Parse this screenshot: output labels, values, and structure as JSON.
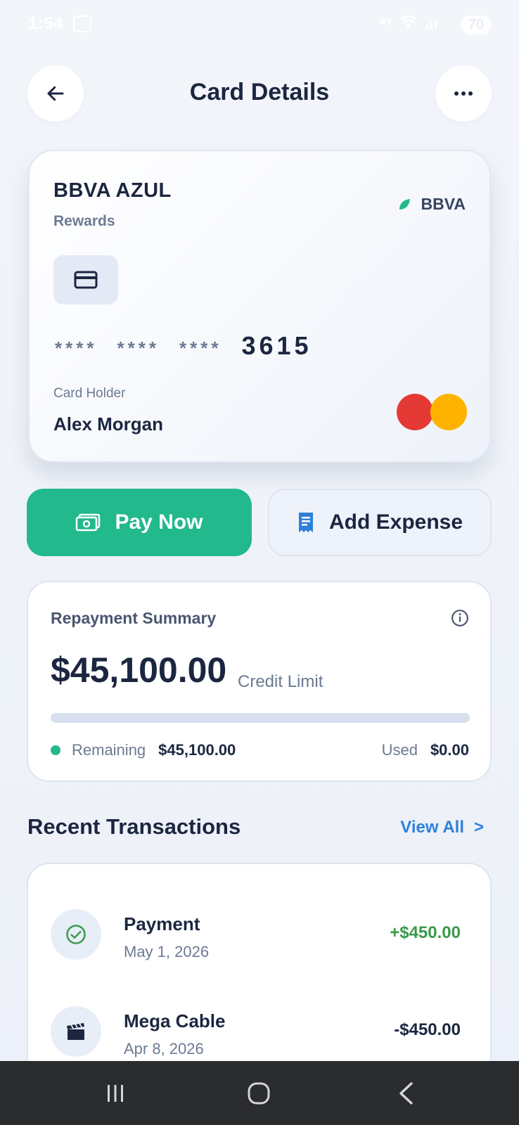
{
  "status_bar": {
    "time": "1:54",
    "battery": "70"
  },
  "header": {
    "title": "Card Details",
    "back_icon": "arrow-left-icon",
    "more_icon": "more-horizontal-icon"
  },
  "card": {
    "name": "BBVA AZUL",
    "tier": "Rewards",
    "bank": "BBVA",
    "number_masked": [
      "****",
      "****",
      "****"
    ],
    "last4": "3615",
    "holder_label": "Card Holder",
    "holder_name": "Alex Morgan",
    "network_icon": "mastercard-logo",
    "colors": {
      "mc_red": "#e53935",
      "mc_yellow": "#ffb300",
      "leaf": "#22b98c"
    }
  },
  "actions": {
    "pay_label": "Pay Now",
    "expense_label": "Add Expense",
    "accent": "#22b98c"
  },
  "summary": {
    "title": "Repayment Summary",
    "amount": "$45,100.00",
    "subtitle": "Credit Limit",
    "used_fraction": 0,
    "remaining_label": "Remaining",
    "remaining_value": "$45,100.00",
    "used_label": "Used",
    "used_value": "$0.00"
  },
  "transactions": {
    "title": "Recent Transactions",
    "view_all": "View All",
    "view_all_chevron": ">",
    "items": [
      {
        "name": "Payment",
        "date": "May 1, 2026",
        "amount": "+$450.00",
        "amount_color": "#3a9a4a",
        "icon": "check-circle-icon"
      },
      {
        "name": "Mega Cable",
        "date": "Apr 8, 2026",
        "amount": "-$450.00",
        "amount_color": "#1c2640",
        "icon": "clapperboard-icon"
      }
    ]
  },
  "nav": {
    "recents_icon": "recents-icon",
    "home_icon": "home-icon",
    "back_icon": "back-icon"
  }
}
